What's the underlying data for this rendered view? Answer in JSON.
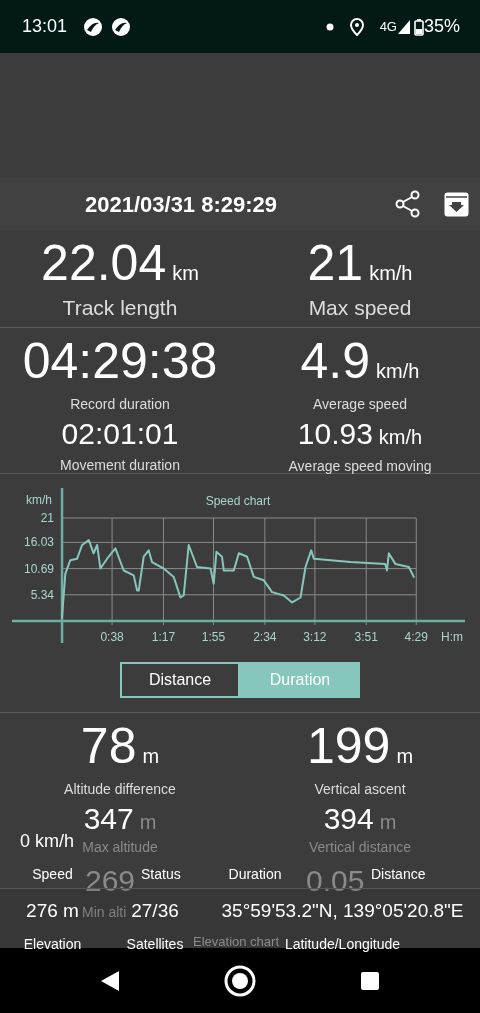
{
  "status_bar": {
    "time": "13:01",
    "network": "4G",
    "battery": "35%"
  },
  "header": {
    "title": "2021/03/31 8:29:29"
  },
  "summary": [
    {
      "value": "22.04",
      "unit": "km",
      "label": "Track length"
    },
    {
      "value": "21",
      "unit": "km/h",
      "label": "Max speed"
    }
  ],
  "details": [
    {
      "value": "04:29:38",
      "label": "Record duration",
      "sub_value": "02:01:01",
      "sub_label": "Movement duration"
    },
    {
      "value": "4.9",
      "unit": "km/h",
      "label": "Average speed",
      "sub_value": "10.93",
      "sub_unit": "km/h",
      "sub_label": "Average speed moving"
    }
  ],
  "speed_chart": {
    "chart_data": {
      "type": "line",
      "title": "Speed chart",
      "xlabel": "H:m",
      "ylabel": "km/h",
      "xlim": [
        -38,
        306
      ],
      "ylim": [
        0,
        21
      ],
      "grid": true,
      "xticks": [
        {
          "value": 38,
          "label": "0:38"
        },
        {
          "value": 77,
          "label": "1:17"
        },
        {
          "value": 115,
          "label": "1:55"
        },
        {
          "value": 154,
          "label": "2:34"
        },
        {
          "value": 192,
          "label": "3:12"
        },
        {
          "value": 231,
          "label": "3:51"
        },
        {
          "value": 269,
          "label": "4:29"
        }
      ],
      "yticks": [
        5.34,
        10.69,
        16.03,
        21
      ],
      "x": [
        0,
        2.5,
        6.3,
        11.4,
        15.2,
        20.3,
        24,
        26.6,
        29.1,
        34.2,
        40.5,
        46.8,
        54.4,
        57,
        58.2,
        62,
        65.8,
        68.3,
        77.2,
        84.8,
        89.9,
        92.4,
        96.2,
        102.5,
        112.7,
        115.2,
        117.2,
        121.5,
        122.8,
        130.4,
        134.2,
        140.5,
        145.6,
        153.2,
        159.5,
        168.4,
        174.7,
        181.1,
        184.9,
        189.2,
        191.2,
        219,
        245.5,
        246.8,
        248.1,
        253.2,
        263.3,
        267.1
      ],
      "series": [
        {
          "color": "#86c6bd",
          "values": [
            0.7,
            9.6,
            12.4,
            12.7,
            15.5,
            16.5,
            13.8,
            15.5,
            10.7,
            12.7,
            14.8,
            10.3,
            9.3,
            6.2,
            6.2,
            13.1,
            14.4,
            12,
            10.7,
            9,
            4.8,
            5.2,
            15.5,
            11,
            10.7,
            7.6,
            14.1,
            13.1,
            10.3,
            10.3,
            13.8,
            13.1,
            9,
            8.3,
            5.9,
            5.2,
            3.8,
            4.8,
            11,
            14.4,
            12.7,
            12,
            11.6,
            10.3,
            13.8,
            11.6,
            11,
            9
          ]
        }
      ]
    }
  },
  "toggle": [
    {
      "label": "Distance",
      "selected": false
    },
    {
      "label": "Duration",
      "selected": true
    }
  ],
  "altitude": [
    {
      "value": "78",
      "unit": "m",
      "label": "Altitude difference",
      "sub_value": "347",
      "sub_unit": "m",
      "sub_label": "Max altitude",
      "third_value": "269",
      "third_label": "Min alti"
    },
    {
      "value": "199",
      "unit": "m",
      "label": "Vertical ascent",
      "sub_value": "394",
      "sub_unit": "m",
      "sub_label": "Vertical distance",
      "third_value": "0.05"
    }
  ],
  "elevation_chart_title": "Elevation chart",
  "live_panel": {
    "speed_value": "0 km/h",
    "top_labels": [
      "Speed",
      "Status",
      "Duration",
      "Distance"
    ],
    "bottom_values": [
      {
        "value": "276 m",
        "label": "Elevation"
      },
      {
        "value": "27/36",
        "label": "Satellites"
      },
      {
        "value": "35°59'53.2\"N, 139°05'20.8\"E",
        "label": "Latitude/Longitude"
      }
    ]
  }
}
